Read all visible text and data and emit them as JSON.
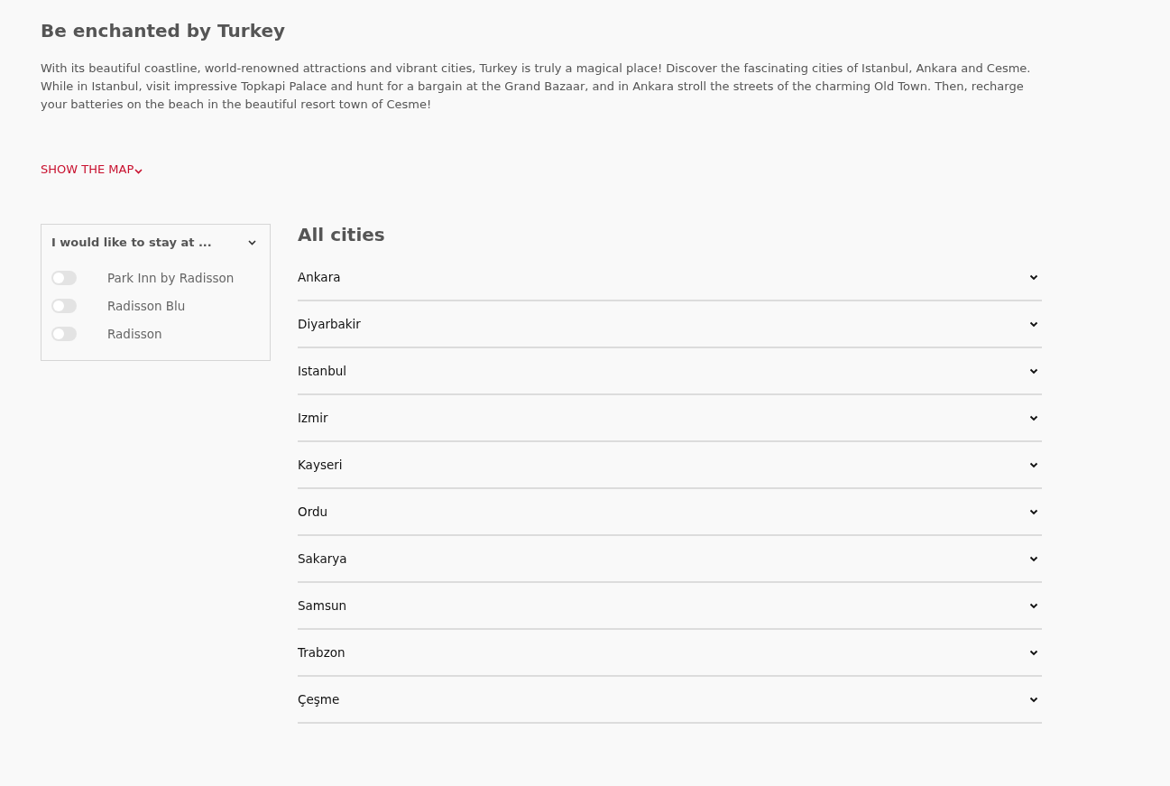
{
  "title": "Be enchanted by Turkey",
  "intro": "With its beautiful coastline, world-renowned attractions and vibrant cities, Turkey is truly a magical place! Discover the fascinating cities of Istanbul, Ankara and Cesme. While in Istanbul, visit impressive Topkapi Palace and hunt for a bargain at the Grand Bazaar, and in Ankara stroll the streets of the charming Old Town. Then, recharge your batteries on the beach in the beautiful resort town of Cesme!",
  "map_link": "SHOW THE MAP",
  "filter": {
    "title": "I would like to stay at ...",
    "options": [
      {
        "label": "Park Inn by Radisson",
        "on": false
      },
      {
        "label": "Radisson Blu",
        "on": false
      },
      {
        "label": "Radisson",
        "on": false
      }
    ]
  },
  "cities_heading": "All cities",
  "cities": [
    {
      "name": "Ankara",
      "expanded": false
    },
    {
      "name": "Diyarbakir",
      "expanded": false
    },
    {
      "name": "Istanbul",
      "expanded": false
    },
    {
      "name": "Izmir",
      "expanded": false
    },
    {
      "name": "Kayseri",
      "expanded": false
    },
    {
      "name": "Ordu",
      "expanded": false
    },
    {
      "name": "Sakarya",
      "expanded": false
    },
    {
      "name": "Samsun",
      "expanded": false
    },
    {
      "name": "Trabzon",
      "expanded": false
    },
    {
      "name": "Çeşme",
      "expanded": false
    }
  ]
}
